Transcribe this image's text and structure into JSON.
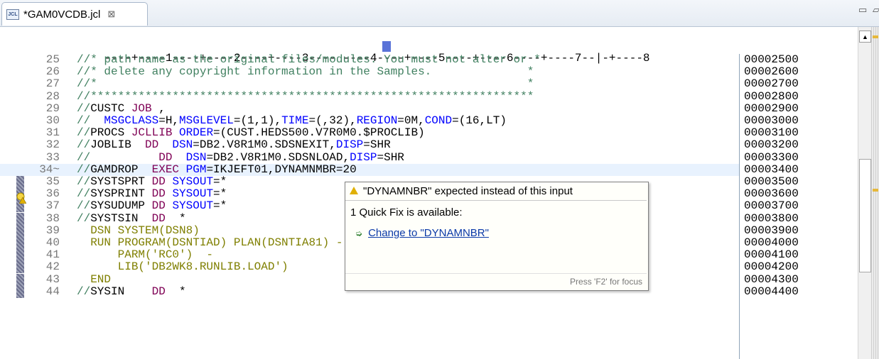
{
  "tab": {
    "icon_text": "JCL",
    "title": "*GAM0VCDB.jcl",
    "close": "⊠"
  },
  "window": {
    "minimize": "▭",
    "maximize": "▱"
  },
  "ruler": "----+----1----+----2----+----3---- ----4----+----5----+----6----+----7--|-+----8",
  "lines": [
    {
      "num": "25",
      "segments": [
        [
          "cm",
          "//* path name as the original files/modules. You must not alter or *"
        ]
      ],
      "seq": "00002500"
    },
    {
      "num": "26",
      "segments": [
        [
          "cm",
          "//* delete any copyright information in the Samples.              *"
        ]
      ],
      "seq": "00002600"
    },
    {
      "num": "27",
      "segments": [
        [
          "cm",
          "//*                                                               *"
        ]
      ],
      "seq": "00002700"
    },
    {
      "num": "28",
      "segments": [
        [
          "cm",
          "//*****************************************************************"
        ]
      ],
      "seq": "00002800"
    },
    {
      "num": "29",
      "segments": [
        [
          "cm",
          "//"
        ],
        [
          "",
          "CUSTC "
        ],
        [
          "kw",
          "JOB"
        ],
        [
          "",
          " ,"
        ]
      ],
      "seq": "00002900"
    },
    {
      "num": "30",
      "segments": [
        [
          "cm",
          "//  "
        ],
        [
          "bl",
          "MSGCLASS"
        ],
        [
          "",
          "=H,"
        ],
        [
          "bl",
          "MSGLEVEL"
        ],
        [
          "",
          "=(1,1),"
        ],
        [
          "bl",
          "TIME"
        ],
        [
          "",
          "=(,32),"
        ],
        [
          "bl",
          "REGION"
        ],
        [
          "",
          "=0M,"
        ],
        [
          "bl",
          "COND"
        ],
        [
          "",
          "=(16,LT)"
        ]
      ],
      "seq": "00003000"
    },
    {
      "num": "31",
      "segments": [
        [
          "cm",
          "//"
        ],
        [
          "",
          "PROCS "
        ],
        [
          "kw",
          "JCLLIB"
        ],
        [
          "",
          " "
        ],
        [
          "bl",
          "ORDER"
        ],
        [
          "",
          "=(CUST.HEDS500.V7R0M0.$PROCLIB)"
        ]
      ],
      "seq": "00003100"
    },
    {
      "num": "32",
      "segments": [
        [
          "cm",
          "//"
        ],
        [
          "",
          "JOBLIB  "
        ],
        [
          "kw",
          "DD"
        ],
        [
          "",
          "  "
        ],
        [
          "bl",
          "DSN"
        ],
        [
          "",
          "=DB2.V8R1M0.SDSNEXIT,"
        ],
        [
          "bl",
          "DISP"
        ],
        [
          "",
          "=SHR"
        ]
      ],
      "seq": "00003200"
    },
    {
      "num": "33",
      "segments": [
        [
          "cm",
          "//"
        ],
        [
          "",
          "          "
        ],
        [
          "kw",
          "DD"
        ],
        [
          "",
          "  "
        ],
        [
          "bl",
          "DSN"
        ],
        [
          "",
          "=DB2.V8R1M0.SDSNLOAD,"
        ],
        [
          "bl",
          "DISP"
        ],
        [
          "",
          "=SHR"
        ]
      ],
      "seq": "00003300"
    },
    {
      "num": "34~",
      "segments": [
        [
          "cm",
          "//"
        ],
        [
          "",
          "GAMDROP  "
        ],
        [
          "kw",
          "EXEC"
        ],
        [
          "",
          " "
        ],
        [
          "bl",
          "PGM"
        ],
        [
          "",
          "=IKJEFT01,DYNAMNMBR=20"
        ]
      ],
      "seq": "00003400",
      "current": true
    },
    {
      "num": "35",
      "segments": [
        [
          "cm",
          "//"
        ],
        [
          "",
          "SYSTSPRT "
        ],
        [
          "kw",
          "DD"
        ],
        [
          "",
          " "
        ],
        [
          "bl",
          "SYSOUT"
        ],
        [
          "",
          "=*"
        ]
      ],
      "seq": "00003500"
    },
    {
      "num": "36",
      "segments": [
        [
          "cm",
          "//"
        ],
        [
          "",
          "SYSPRINT "
        ],
        [
          "kw",
          "DD"
        ],
        [
          "",
          " "
        ],
        [
          "bl",
          "SYSOUT"
        ],
        [
          "",
          "=*"
        ]
      ],
      "seq": "00003600"
    },
    {
      "num": "37",
      "segments": [
        [
          "cm",
          "//"
        ],
        [
          "",
          "SYSUDUMP "
        ],
        [
          "kw",
          "DD"
        ],
        [
          "",
          " "
        ],
        [
          "bl",
          "SYSOUT"
        ],
        [
          "",
          "=*"
        ]
      ],
      "seq": "00003700"
    },
    {
      "num": "38",
      "segments": [
        [
          "cm",
          "//"
        ],
        [
          "",
          "SYSTSIN  "
        ],
        [
          "kw",
          "DD"
        ],
        [
          "",
          "  *"
        ]
      ],
      "seq": "00003800"
    },
    {
      "num": "39",
      "segments": [
        [
          "ol",
          "  DSN SYSTEM(DSN8)"
        ]
      ],
      "seq": "00003900"
    },
    {
      "num": "40",
      "segments": [
        [
          "ol",
          "  RUN PROGRAM(DSNTIAD) PLAN(DSNTIA81) -"
        ]
      ],
      "seq": "00004000"
    },
    {
      "num": "41",
      "segments": [
        [
          "ol",
          "      PARM('RC0')  -"
        ]
      ],
      "seq": "00004100"
    },
    {
      "num": "42",
      "segments": [
        [
          "ol",
          "      LIB('DB2WK8.RUNLIB.LOAD')"
        ]
      ],
      "seq": "00004200"
    },
    {
      "num": "43",
      "segments": [
        [
          "ol",
          "  END"
        ]
      ],
      "seq": "00004300"
    },
    {
      "num": "44",
      "segments": [
        [
          "cm",
          "//"
        ],
        [
          "",
          "SYSIN    "
        ],
        [
          "kw",
          "DD"
        ],
        [
          "",
          "  *"
        ]
      ],
      "seq": "00004400"
    }
  ],
  "tooltip": {
    "title": "\"DYNAMNBR\" expected instead of this input",
    "subtitle": "1 Quick Fix is available:",
    "fix_label": "Change to \"DYNAMNBR\"",
    "footer": "Press 'F2' for focus"
  },
  "colors": {
    "comment": "#3f7f5f",
    "keyword": "#7f0055",
    "param": "#0000ff",
    "instream": "#7f7f00",
    "current_line": "#e8f2fe"
  }
}
